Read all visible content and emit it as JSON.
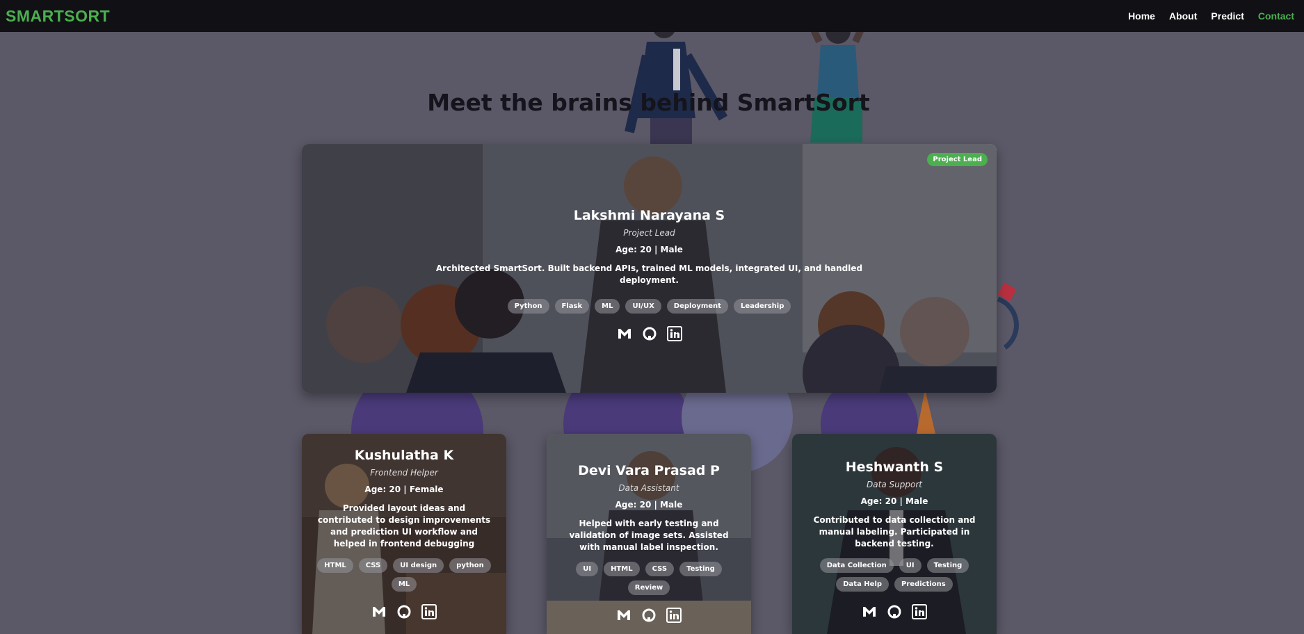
{
  "nav": {
    "brand": "SMARTSORT",
    "links": [
      "Home",
      "About",
      "Predict",
      "Contact"
    ],
    "active": "Contact"
  },
  "page": {
    "title": "Meet the brains behind SmartSort"
  },
  "colors": {
    "accent": "#4caf50",
    "navbar": "#111115",
    "background": "#5b5867"
  },
  "lead": {
    "badge": "Project Lead",
    "name": "Lakshmi Narayana S",
    "role": "Project Lead",
    "age": "Age: 20 | Male",
    "desc": "Architected SmartSort. Built backend APIs, trained ML models, integrated UI, and handled deployment.",
    "tags": [
      "Python",
      "Flask",
      "ML",
      "UI/UX",
      "Deployment",
      "Leadership"
    ],
    "icons": [
      "gmail-icon",
      "github-icon",
      "linkedin-icon"
    ]
  },
  "members": [
    {
      "name": "Kushulatha K",
      "role": "Frontend Helper",
      "age": "Age: 20 | Female",
      "desc": "Provided layout ideas and contributed to design improvements and prediction UI workflow and helped in frontend debugging",
      "tags": [
        "HTML",
        "CSS",
        "UI design",
        "python",
        "ML"
      ]
    },
    {
      "name": "Devi Vara Prasad P",
      "role": "Data Assistant",
      "age": "Age: 20 | Male",
      "desc": "Helped with early testing and validation of image sets. Assisted with manual label inspection.",
      "tags": [
        "UI",
        "HTML",
        "CSS",
        "Testing",
        "Review"
      ]
    },
    {
      "name": "Heshwanth S",
      "role": "Data Support",
      "age": "Age: 20 | Male",
      "desc": "Contributed to data collection and manual labeling. Participated in backend testing.",
      "tags": [
        "Data Collection",
        "UI",
        "Testing",
        "Data Help",
        "Predictions"
      ]
    }
  ]
}
